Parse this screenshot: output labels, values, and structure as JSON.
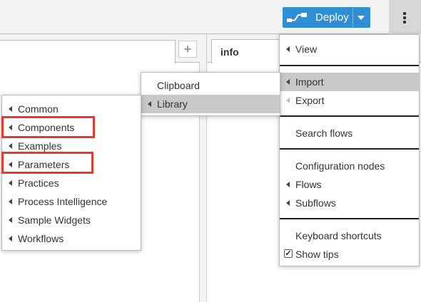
{
  "header": {
    "deploy_label": "Deploy",
    "deploy_color": "#2f8ed4",
    "icons": {
      "deploy": "deploy-flow-icon",
      "menu": "kebab-menu-icon",
      "add": "plus-icon"
    }
  },
  "workspace": {
    "add_tab_label": "+"
  },
  "sidebar": {
    "tab_label": "info"
  },
  "main_menu": {
    "items": [
      {
        "label": "View"
      },
      {
        "label": "Import"
      },
      {
        "label": "Export"
      },
      {
        "label": "Search flows"
      },
      {
        "label": "Configuration nodes"
      },
      {
        "label": "Flows"
      },
      {
        "label": "Subflows"
      },
      {
        "label": "Keyboard shortcuts"
      },
      {
        "label": "Show tips",
        "checked": true
      }
    ],
    "active_item": "Import"
  },
  "import_menu": {
    "items": [
      {
        "label": "Clipboard"
      },
      {
        "label": "Library"
      }
    ],
    "active_item": "Library"
  },
  "library_menu": {
    "items": [
      {
        "label": "Common"
      },
      {
        "label": "Components"
      },
      {
        "label": "Examples"
      },
      {
        "label": "Parameters"
      },
      {
        "label": "Practices"
      },
      {
        "label": "Process Intelligence"
      },
      {
        "label": "Sample Widgets"
      },
      {
        "label": "Workflows"
      }
    ],
    "highlighted": [
      "Components",
      "Parameters"
    ],
    "highlight_color": "#e53b2f"
  }
}
